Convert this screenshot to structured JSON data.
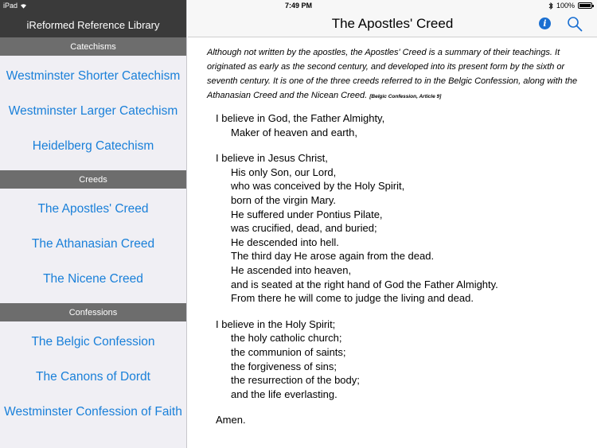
{
  "status": {
    "device": "iPad",
    "time": "7:49 PM",
    "battery_text": "100%",
    "battery_level": 1.0
  },
  "sidebar": {
    "title": "iReformed Reference Library",
    "sections": [
      {
        "header": "Catechisms",
        "items": [
          "Westminster Shorter Catechism",
          "Westminster Larger Catechism",
          "Heidelberg Catechism"
        ]
      },
      {
        "header": "Creeds",
        "items": [
          "The Apostles' Creed",
          "The Athanasian Creed",
          "The Nicene Creed"
        ]
      },
      {
        "header": "Confessions",
        "items": [
          "The Belgic Confession",
          "The Canons of Dordt",
          "Westminster Confession of Faith"
        ]
      }
    ]
  },
  "header": {
    "title": "The Apostles' Creed",
    "info_icon": "info-icon",
    "search_icon": "search-icon",
    "accent_color": "#1a6fd1"
  },
  "content": {
    "intro": "Although not written by the apostles, the Apostles' Creed is a summary of their teachings. It originated as early as the second century, and developed into its present form by the sixth or seventh century. It is one of the three creeds referred to in the Belgic Confession, along with the Athanasian Creed and the Nicean Creed.",
    "citation": "[Belgic Confession, Article 9]",
    "stanzas": [
      {
        "first": "I believe in God, the Father Almighty,",
        "lines": [
          "Maker of heaven and earth,"
        ]
      },
      {
        "first": "I believe in Jesus Christ,",
        "lines": [
          "His only Son, our Lord,",
          "who was conceived by the Holy Spirit,",
          "born of the virgin Mary.",
          "He suffered under Pontius Pilate,",
          "was crucified, dead, and buried;",
          "He descended into hell.",
          "The third day He arose again from the dead.",
          "He ascended into heaven,",
          "and is seated at the right hand of God the Father Almighty.",
          "From there he will come to judge the living and dead."
        ]
      },
      {
        "first": "I believe in the Holy Spirit;",
        "lines": [
          "the holy catholic church;",
          "the communion of saints;",
          "the forgiveness of sins;",
          "the resurrection of the body;",
          "and the life everlasting."
        ]
      },
      {
        "first": "Amen.",
        "lines": []
      }
    ]
  }
}
